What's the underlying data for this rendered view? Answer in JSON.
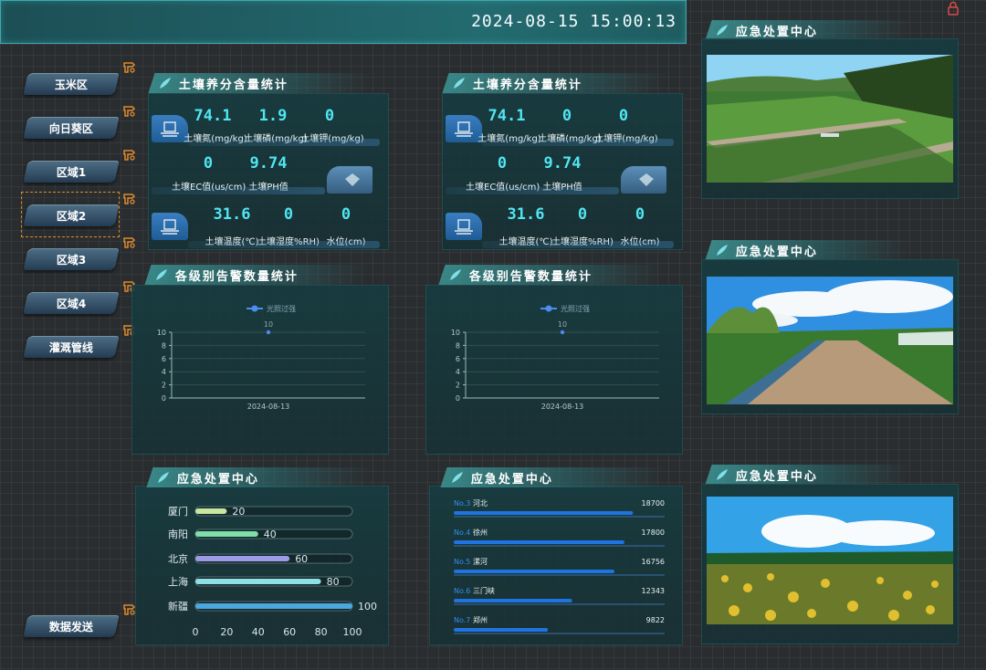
{
  "header": {
    "datetime": "2024-08-15 15:00:13"
  },
  "nav": [
    "玉米区",
    "向日葵区",
    "区域1",
    "区域2",
    "区域3",
    "区域4",
    "灌溉管线"
  ],
  "nav_bottom": "数据发送",
  "soil": [
    {
      "title": "土壤养分含量统计",
      "r1": {
        "vals": [
          "74.1",
          "1.9",
          "0"
        ],
        "labels": [
          "土壤氮(mg/kg)",
          "土壤磷(mg/kg)",
          "土壤钾(mg/kg)"
        ]
      },
      "r2": {
        "vals": [
          "0",
          "9.74"
        ],
        "labels": [
          "土壤EC值(us/cm)",
          "土壤PH值"
        ]
      },
      "r3": {
        "vals": [
          "31.6",
          "0",
          "0"
        ],
        "labels": [
          "土壤温度(℃)",
          "土壤湿度%RH)",
          "水位(cm)"
        ]
      }
    },
    {
      "title": "土壤养分含量统计",
      "r1": {
        "vals": [
          "74.1",
          "0",
          "0"
        ],
        "labels": [
          "土壤氮(mg/kg)",
          "土壤磷(mg/kg)",
          "土壤钾(mg/kg)"
        ]
      },
      "r2": {
        "vals": [
          "0",
          "9.74"
        ],
        "labels": [
          "土壤EC值(us/cm)",
          "土壤PH值"
        ]
      },
      "r3": {
        "vals": [
          "31.6",
          "0",
          "0"
        ],
        "labels": [
          "土壤温度(℃)",
          "土壤湿度%RH)",
          "水位(cm)"
        ]
      }
    }
  ],
  "alerts": [
    {
      "title": "各级别告警数量统计"
    },
    {
      "title": "各级别告警数量统计"
    }
  ],
  "chart_data": [
    {
      "type": "line",
      "legend": [
        "光照过强"
      ],
      "categories": [
        "2024-08-13"
      ],
      "series": [
        {
          "name": "光照过强",
          "values": [
            10
          ]
        }
      ],
      "yticks": [
        "0",
        "2",
        "4",
        "6",
        "8",
        "10"
      ],
      "ylim": [
        0,
        10
      ],
      "legend_position": "top-center",
      "data_labels": [
        "10"
      ]
    },
    {
      "type": "line",
      "legend": [
        "光照过强"
      ],
      "categories": [
        "2024-08-13"
      ],
      "series": [
        {
          "name": "光照过强",
          "values": [
            10
          ]
        }
      ],
      "yticks": [
        "0",
        "2",
        "4",
        "6",
        "8",
        "10"
      ],
      "ylim": [
        0,
        10
      ],
      "legend_position": "top-center",
      "data_labels": [
        "10"
      ]
    },
    {
      "type": "bar",
      "orientation": "horizontal",
      "title": "应急处置中心",
      "categories": [
        "厦门",
        "南阳",
        "北京",
        "上海",
        "新疆"
      ],
      "values": [
        20,
        40,
        60,
        80,
        100
      ],
      "value_labels": [
        "20",
        "40",
        "60",
        "80",
        "100"
      ],
      "xticks": [
        "0",
        "20",
        "40",
        "60",
        "80",
        "100"
      ],
      "xlim": [
        0,
        100
      ],
      "colors": [
        "#c8e6a0",
        "#7ee0a8",
        "#9d9ae6",
        "#8ee0e8",
        "#4aa8e0"
      ]
    },
    {
      "type": "bar",
      "orientation": "horizontal",
      "title": "应急处置中心",
      "categories": [
        "No.3",
        "No.4",
        "No.5",
        "No.6",
        "No.7"
      ],
      "names": [
        "河北",
        "徐州",
        "漯河",
        "三门峡",
        "郑州"
      ],
      "values": [
        18700,
        17800,
        16756,
        12343,
        9822
      ],
      "value_labels": [
        "18700",
        "17800",
        "16756",
        "12343",
        "9822"
      ],
      "xlim": [
        0,
        22000
      ],
      "color": "#1e74e0"
    }
  ],
  "right_titles": [
    "应急处置中心",
    "应急处置中心",
    "应急处置中心"
  ]
}
